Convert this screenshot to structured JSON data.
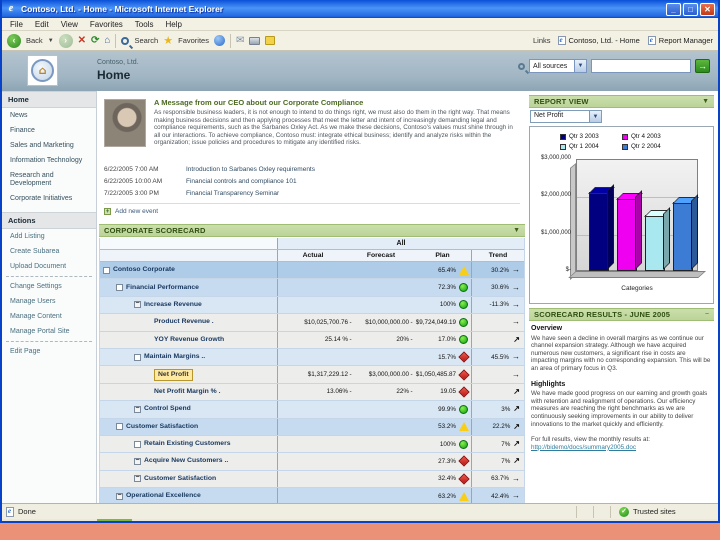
{
  "window": {
    "title": "Contoso, Ltd. - Home - Microsoft Internet Explorer",
    "menus": [
      "File",
      "Edit",
      "View",
      "Favorites",
      "Tools",
      "Help"
    ],
    "toolbar": {
      "back_label": "Back",
      "search_label": "Search",
      "favorites_label": "Favorites",
      "links_label": "Links",
      "links": [
        "Contoso, Ltd. - Home",
        "Report Manager"
      ]
    },
    "status": {
      "left": "Done",
      "zone": "Trusted sites"
    }
  },
  "banner": {
    "site": "Contoso, Ltd.",
    "page": "Home",
    "search_scope": "All sources",
    "search_value": ""
  },
  "sidebar": {
    "nav": {
      "header": "Home",
      "items": [
        "News",
        "Finance",
        "Sales and Marketing",
        "Information Technology",
        "Research and Development",
        "Corporate Initiatives"
      ]
    },
    "actions": {
      "header": "Actions",
      "groups": [
        [
          "Add Listing",
          "Create Subarea",
          "Upload Document"
        ],
        [
          "Change Settings",
          "Manage Users",
          "Manage Content",
          "Manage Portal Site"
        ],
        [
          "Edit Page"
        ]
      ]
    }
  },
  "ceo_message": {
    "title": "A Message from our CEO about our Corporate Compliance",
    "body": "As responsible business leaders, it is not enough to intend to do things right, we must also do them in the right way. That means making business decisions and then applying processes that meet the letter and intent of increasingly demanding legal and compliance requirements, such as the Sarbanes Oxley Act. As we make these decisions, Contoso's values must shine through in all our interactions. To achieve compliance, Contoso must: integrate ethical business; identify and analyze risks within the organization; issue policies and procedures to mitigate any identified risks."
  },
  "events": [
    {
      "date": "6/22/2005 7:00 AM",
      "title": "Introduction to Sarbanes Oxley requirements"
    },
    {
      "date": "6/22/2005 10:00 AM",
      "title": "Financial controls and compliance 101"
    },
    {
      "date": "7/22/2005 3:00 PM",
      "title": "Financial Transparency Seminar"
    }
  ],
  "add_event_label": "Add new event",
  "scorecard": {
    "title": "CORPORATE SCORECARD",
    "group_header": "All",
    "columns": [
      "Actual",
      "Forecast",
      "Plan",
      "Trend"
    ],
    "rows": [
      {
        "label": "Contoso Corporate",
        "indent": 0,
        "control": "checkbox",
        "actual": "",
        "forecast": "",
        "plan": "65.4%",
        "status": "yellow",
        "trend": "30.2%",
        "arrow": "right",
        "bg": "level0",
        "highlight": false
      },
      {
        "label": "Financial Performance",
        "indent": 1,
        "control": "checkbox",
        "actual": "",
        "forecast": "",
        "plan": "72.3%",
        "status": "green",
        "trend": "30.6%",
        "arrow": "right",
        "bg": "level1",
        "highlight": false
      },
      {
        "label": "Increase Revenue",
        "indent": 2,
        "control": "minus",
        "actual": "",
        "forecast": "",
        "plan": "100%",
        "status": "green",
        "trend": "-11.3%",
        "arrow": "right",
        "bg": "level2",
        "highlight": false
      },
      {
        "label": "Product Revenue .",
        "indent": 3,
        "control": "none",
        "actual": "$10,025,700.76",
        "forecast": "$10,000,000.00",
        "plan": "$9,724,049.19",
        "status": "green",
        "trend": "",
        "arrow": "right",
        "bg": "leaf",
        "highlight": false
      },
      {
        "label": "YOY Revenue Growth",
        "indent": 3,
        "control": "none",
        "actual": "25.14 %",
        "forecast": "20%",
        "plan": "17.0%",
        "status": "green",
        "trend": "",
        "arrow": "up",
        "bg": "leaf",
        "highlight": false
      },
      {
        "label": "Maintain Margins ..",
        "indent": 2,
        "control": "checkbox",
        "actual": "",
        "forecast": "",
        "plan": "15.7%",
        "status": "red",
        "trend": "45.5%",
        "arrow": "right",
        "bg": "level2",
        "highlight": false
      },
      {
        "label": "Net Profit",
        "indent": 3,
        "control": "none",
        "actual": "$1,317,229.12",
        "forecast": "$3,000,000.00",
        "plan": "$1,050,485.87",
        "status": "red",
        "trend": "",
        "arrow": "right",
        "bg": "leaf",
        "highlight": true
      },
      {
        "label": "Net Profit Margin % .",
        "indent": 3,
        "control": "none",
        "actual": "13.06%",
        "forecast": "22%",
        "plan": "19.05",
        "status": "red",
        "trend": "",
        "arrow": "up",
        "bg": "leaf",
        "highlight": false
      },
      {
        "label": "Control Spend",
        "indent": 2,
        "control": "minus",
        "actual": "",
        "forecast": "",
        "plan": "99.9%",
        "status": "green",
        "trend": "3%",
        "arrow": "up",
        "bg": "level2",
        "highlight": false
      },
      {
        "label": "Customer Satisfaction",
        "indent": 1,
        "control": "checkbox",
        "actual": "",
        "forecast": "",
        "plan": "53.2%",
        "status": "yellow",
        "trend": "22.2%",
        "arrow": "up",
        "bg": "level1",
        "highlight": false
      },
      {
        "label": "Retain Existing Customers",
        "indent": 2,
        "control": "checkbox",
        "actual": "",
        "forecast": "",
        "plan": "100%",
        "status": "green",
        "trend": "7%",
        "arrow": "up",
        "bg": "leaf",
        "highlight": false
      },
      {
        "label": "Acquire New Customers ..",
        "indent": 2,
        "control": "minus",
        "actual": "",
        "forecast": "",
        "plan": "27.3%",
        "status": "red",
        "trend": "7%",
        "arrow": "up",
        "bg": "leaf",
        "highlight": false
      },
      {
        "label": "Customer Satisfaction",
        "indent": 2,
        "control": "minus",
        "actual": "",
        "forecast": "",
        "plan": "32.4%",
        "status": "red",
        "trend": "63.7%",
        "arrow": "right",
        "bg": "leaf",
        "highlight": false
      },
      {
        "label": "Operational Excellence",
        "indent": 1,
        "control": "minus",
        "actual": "",
        "forecast": "",
        "plan": "63.2%",
        "status": "yellow",
        "trend": "42.4%",
        "arrow": "right",
        "bg": "level1",
        "highlight": false
      }
    ]
  },
  "report_view": {
    "title": "REPORT VIEW",
    "selector": "Net Profit"
  },
  "chart_data": {
    "type": "bar",
    "title": "Net Profit",
    "categories": [
      "Qtr 3 2003",
      "Qtr 4 2003",
      "Qtr 1 2004",
      "Qtr 2 2004"
    ],
    "values": [
      2050000,
      1900000,
      1450000,
      1800000
    ],
    "colors": [
      "#000080",
      "#F000F0",
      "#A8E8EE",
      "#3C7CD4"
    ],
    "xlabel": "Categories",
    "ylabel": "",
    "ylim": [
      0,
      3000000
    ],
    "ytick_labels": [
      "$3,000,000",
      "$2,000,000",
      "$1,000,000",
      "$-"
    ],
    "legend_position": "top",
    "grid": true
  },
  "results_panel": {
    "title": "SCORECARD RESULTS - JUNE 2005",
    "overview_heading": "Overview",
    "overview": "We have seen a decline in overall margins as we continue our channel expansion strategy. Although we have acquired numerous new customers, a significant rise in costs are impacting margins with no corresponding expansion. This will be an area of primary focus in Q3.",
    "highlights_heading": "Highlights",
    "highlights": "We have made good progress on our earning and growth goals with retention and realignment of operations. Our efficiency measures are reaching the right benchmarks as we are continuously seeking improvements in our ability to deliver innovations to the market quickly and efficiently.",
    "link_intro": "For full results, view the monthly results at:",
    "link": "http://bidemo/docs/summary2005.doc"
  }
}
